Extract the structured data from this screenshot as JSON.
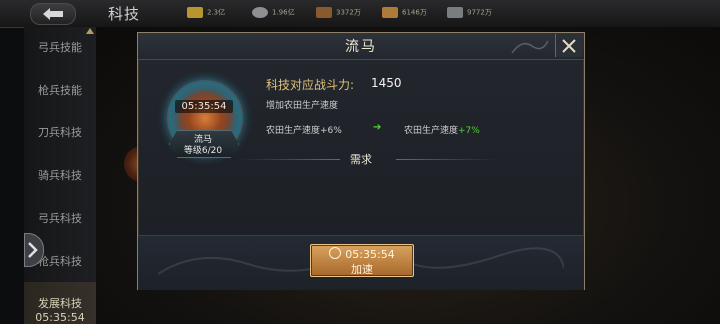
{
  "top_bar": {
    "title": "科技",
    "resources": [
      {
        "icon": "grain-icon",
        "value": "2.3亿"
      },
      {
        "icon": "silver-icon",
        "value": "1.96亿"
      },
      {
        "icon": "wood-icon",
        "value": "3372万"
      },
      {
        "icon": "iron-icon",
        "value": "6146万"
      },
      {
        "icon": "stone-icon",
        "value": "9772万"
      }
    ]
  },
  "sidebar": {
    "items": [
      {
        "label": "弓兵技能"
      },
      {
        "label": "枪兵技能"
      },
      {
        "label": "刀兵科技"
      },
      {
        "label": "骑兵科技"
      },
      {
        "label": "弓兵科技"
      },
      {
        "label": "枪兵科技"
      },
      {
        "label": "发展科技",
        "sub": "05:35:54"
      }
    ]
  },
  "dialog": {
    "title": "流马",
    "emblem": {
      "timer": "05:35:54",
      "name": "流马",
      "level": "等级6/20"
    },
    "power_label": "科技对应战斗力:",
    "power_value": "1450",
    "description": "增加农田生产速度",
    "stat_before": "农田生产速度+6%",
    "stat_after_prefix": "农田生产速度",
    "stat_after_value": "+7%",
    "requirements_label": "需求",
    "speedup_button": {
      "time": "05:35:54",
      "label": "加速"
    }
  },
  "colors": {
    "accent_gold": "#e0c07a",
    "increase_green": "#4cd236",
    "button_orange": "#c4864a"
  }
}
